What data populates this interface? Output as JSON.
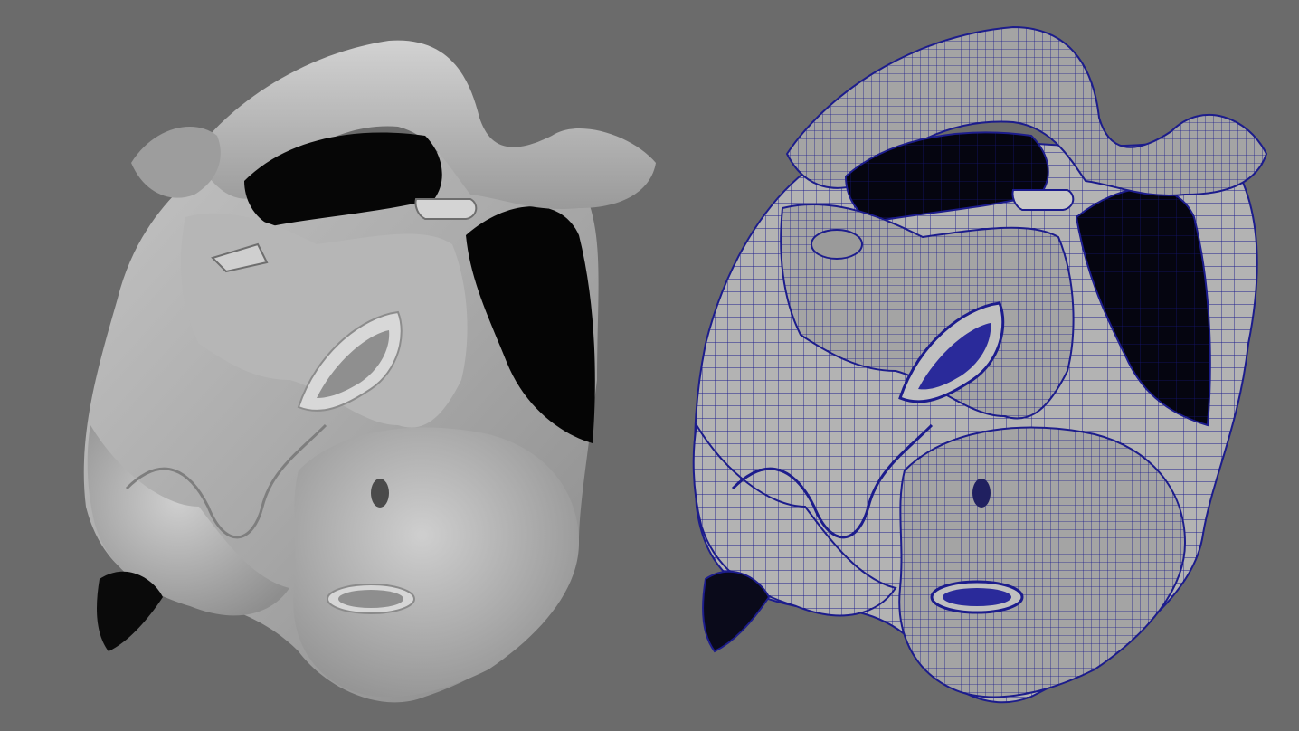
{
  "scene": {
    "background_color": "#6b6b6b",
    "views": [
      {
        "name": "shaded-render",
        "style": "smooth grey shaded surface"
      },
      {
        "name": "wireframe-render",
        "style": "grey shaded surface with blue wireframe overlay",
        "wire_color": "#1c1c8c"
      }
    ],
    "body_color": "#a8a8a8",
    "cavity_color": "#050505"
  }
}
